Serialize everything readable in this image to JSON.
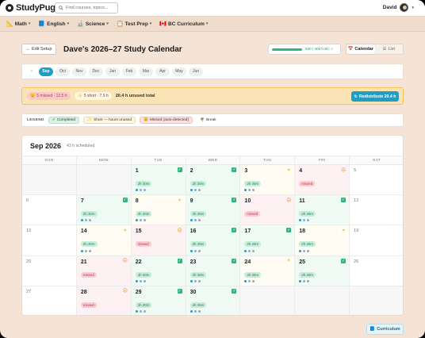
{
  "app": {
    "brand": "StudyPug",
    "search_placeholder": "Find courses, topics...",
    "user_name": "David"
  },
  "subnav": [
    {
      "label": "Math",
      "icon": "ruler-icon",
      "glyph": "📐"
    },
    {
      "label": "English",
      "icon": "book-icon",
      "glyph": "📘"
    },
    {
      "label": "Science",
      "icon": "flask-icon",
      "glyph": "🔬"
    },
    {
      "label": "Test Prep",
      "icon": "clipboard-icon",
      "glyph": "📋"
    },
    {
      "label": "BC Curriculum",
      "icon": "flag-icon",
      "glyph": "🇨🇦"
    }
  ],
  "header": {
    "edit_setup_label": "Edit Setup",
    "title": "Dave's 2026–27 Study Calendar",
    "progress_text": "530 / 400 h BC ✓",
    "progress_fraction": 1.0,
    "view_calendar_label": "Calendar",
    "view_list_label": "List"
  },
  "months": [
    "Sep",
    "Oct",
    "Nov",
    "Dec",
    "Jan",
    "Feb",
    "Mar",
    "Apr",
    "May",
    "Jun"
  ],
  "active_month": "Sep",
  "warning": {
    "missed_text": "5 missed · 12.5 h",
    "short_text": "5 short · 7.9 h",
    "unused_text": "20.4 h unused total",
    "redistribute_label": "Redistribute 20.4 h"
  },
  "legend": {
    "label": "LEGEND",
    "completed": "Completed",
    "short": "Short — hours unused",
    "missed": "Missed (auto-detected)",
    "break": "Break"
  },
  "calendar": {
    "month_label": "Sep 2026",
    "scheduled_label": "43 h scheduled",
    "days_of_week": [
      "SUN",
      "MON",
      "TUE",
      "WED",
      "THU",
      "FRI",
      "SAT"
    ],
    "cells": [
      {
        "day": "",
        "status": "empty"
      },
      {
        "day": "",
        "status": "empty"
      },
      {
        "day": "1",
        "status": "completed",
        "pill": "2h 30m",
        "dots": 3
      },
      {
        "day": "2",
        "status": "completed",
        "pill": "2h 30m",
        "dots": 3
      },
      {
        "day": "3",
        "status": "short",
        "pill": "2h 30m",
        "dots": 3
      },
      {
        "day": "4",
        "status": "missed",
        "pill": "missed",
        "dots": 0
      },
      {
        "day": "5",
        "status": "weekend"
      },
      {
        "day": "6",
        "status": "weekend"
      },
      {
        "day": "7",
        "status": "completed",
        "pill": "2h 30m",
        "dots": 3
      },
      {
        "day": "8",
        "status": "short",
        "pill": "2h 30m",
        "dots": 3
      },
      {
        "day": "9",
        "status": "completed",
        "pill": "2h 30m",
        "dots": 3
      },
      {
        "day": "10",
        "status": "missed",
        "pill": "missed",
        "dots": 0
      },
      {
        "day": "11",
        "status": "completed",
        "pill": "2h 30m",
        "dots": 3
      },
      {
        "day": "12",
        "status": "weekend"
      },
      {
        "day": "13",
        "status": "weekend"
      },
      {
        "day": "14",
        "status": "short",
        "pill": "2h 30m",
        "dots": 3
      },
      {
        "day": "15",
        "status": "missed",
        "pill": "missed",
        "dots": 0
      },
      {
        "day": "16",
        "status": "completed",
        "pill": "2h 30m",
        "dots": 3
      },
      {
        "day": "17",
        "status": "completed",
        "pill": "2h 30m",
        "dots": 3
      },
      {
        "day": "18",
        "status": "short",
        "pill": "2h 30m",
        "dots": 3
      },
      {
        "day": "19",
        "status": "weekend"
      },
      {
        "day": "20",
        "status": "weekend"
      },
      {
        "day": "21",
        "status": "missed",
        "pill": "missed",
        "dots": 0
      },
      {
        "day": "22",
        "status": "completed",
        "pill": "2h 30m",
        "dots": 3
      },
      {
        "day": "23",
        "status": "completed",
        "pill": "2h 30m",
        "dots": 3
      },
      {
        "day": "24",
        "status": "short",
        "pill": "2h 30m",
        "dots": 3
      },
      {
        "day": "25",
        "status": "completed",
        "pill": "2h 30m",
        "dots": 3
      },
      {
        "day": "26",
        "status": "weekend"
      },
      {
        "day": "27",
        "status": "weekend"
      },
      {
        "day": "28",
        "status": "missed",
        "pill": "missed",
        "dots": 0
      },
      {
        "day": "29",
        "status": "completed",
        "pill": "2h 30m",
        "dots": 3
      },
      {
        "day": "30",
        "status": "completed",
        "pill": "2h 30m",
        "dots": 3
      },
      {
        "day": "",
        "status": "empty"
      },
      {
        "day": "",
        "status": "empty"
      },
      {
        "day": "",
        "status": "empty"
      }
    ]
  },
  "colors": {
    "accent": "#1d9fc5",
    "completed": "#2fb67a",
    "missed": "#e15b73",
    "short": "#e8b44a",
    "background": "#f5e3d5"
  },
  "footer": {
    "curriculum_label": "Curriculum"
  }
}
